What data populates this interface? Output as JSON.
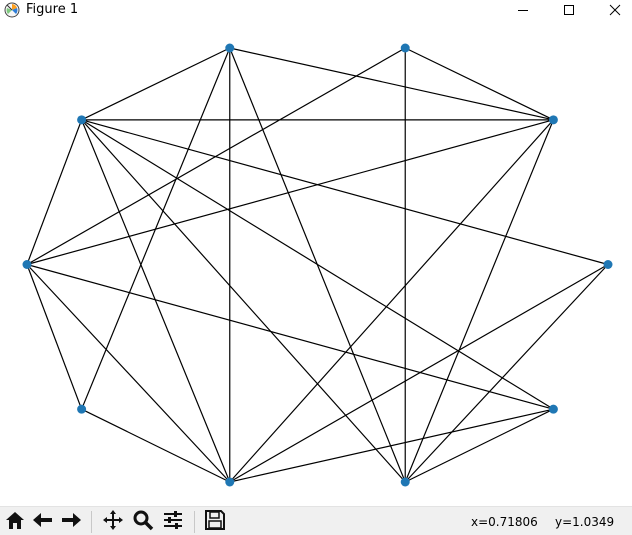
{
  "window": {
    "title": "Figure 1"
  },
  "titlebar_buttons": {
    "minimize_icon": "minimize-icon",
    "maximize_icon": "maximize-icon",
    "close_icon": "close-icon"
  },
  "toolbar": {
    "tools": [
      "home-icon",
      "back-arrow-icon",
      "forward-arrow-icon",
      "pan-move-icon",
      "zoom-magnifier-icon",
      "configure-subplots-icon",
      "save-floppy-icon"
    ],
    "status_x": "x=0.71806",
    "status_y": "y=1.0349"
  },
  "graph": {
    "node_color": "#1f77b4",
    "edge_color": "#000000",
    "nodes": [
      {
        "id": 0,
        "name": "top-left",
        "ax": 0.349,
        "ay": 0.921
      },
      {
        "id": 1,
        "name": "top-right",
        "ax": 0.651,
        "ay": 0.921
      },
      {
        "id": 2,
        "name": "upper-left",
        "ax": 0.094,
        "ay": 0.776
      },
      {
        "id": 3,
        "name": "upper-right",
        "ax": 0.906,
        "ay": 0.776
      },
      {
        "id": 4,
        "name": "mid-left",
        "ax": 0.0,
        "ay": 0.484
      },
      {
        "id": 5,
        "name": "mid-right",
        "ax": 1.0,
        "ay": 0.484
      },
      {
        "id": 6,
        "name": "lower-left",
        "ax": 0.094,
        "ay": 0.192
      },
      {
        "id": 7,
        "name": "lower-right",
        "ax": 0.906,
        "ay": 0.192
      },
      {
        "id": 8,
        "name": "bottom-left",
        "ax": 0.349,
        "ay": 0.045
      },
      {
        "id": 9,
        "name": "bottom-right",
        "ax": 0.651,
        "ay": 0.045
      }
    ],
    "edges": [
      [
        0,
        2
      ],
      [
        0,
        3
      ],
      [
        0,
        6
      ],
      [
        0,
        8
      ],
      [
        0,
        9
      ],
      [
        1,
        4
      ],
      [
        1,
        3
      ],
      [
        1,
        9
      ],
      [
        2,
        3
      ],
      [
        2,
        4
      ],
      [
        2,
        5
      ],
      [
        2,
        7
      ],
      [
        2,
        8
      ],
      [
        2,
        9
      ],
      [
        3,
        4
      ],
      [
        3,
        8
      ],
      [
        3,
        9
      ],
      [
        4,
        6
      ],
      [
        4,
        7
      ],
      [
        4,
        8
      ],
      [
        5,
        8
      ],
      [
        5,
        9
      ],
      [
        6,
        8
      ],
      [
        7,
        8
      ],
      [
        7,
        9
      ]
    ]
  }
}
